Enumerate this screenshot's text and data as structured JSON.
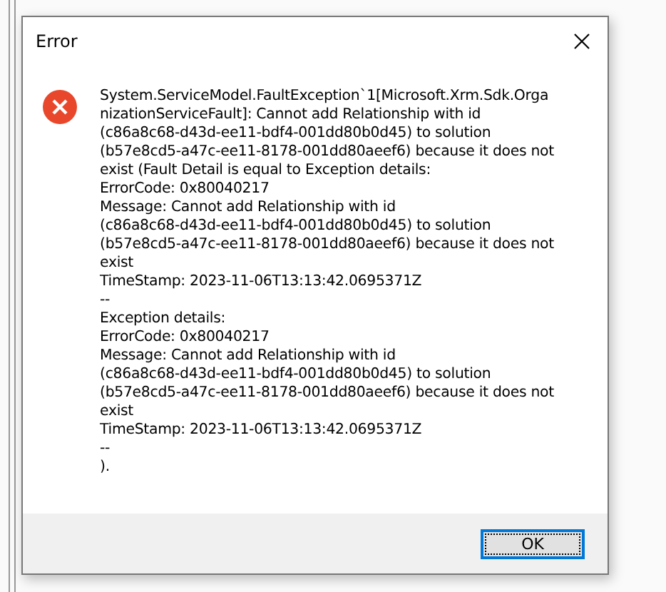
{
  "dialog": {
    "title": "Error",
    "message_lines": [
      "System.ServiceModel.FaultException`1[Microsoft.Xrm.Sdk.Orga",
      "nizationServiceFault]: Cannot add Relationship with id",
      "(c86a8c68-d43d-ee11-bdf4-001dd80b0d45) to solution",
      "(b57e8cd5-a47c-ee11-8178-001dd80aeef6) because it does not",
      "exist (Fault Detail is equal to Exception details:",
      "ErrorCode: 0x80040217",
      "Message: Cannot add Relationship with id",
      "(c86a8c68-d43d-ee11-bdf4-001dd80b0d45) to solution",
      "(b57e8cd5-a47c-ee11-8178-001dd80aeef6) because it does not",
      "exist",
      "TimeStamp: 2023-11-06T13:13:42.0695371Z",
      "--",
      "Exception details:",
      "ErrorCode: 0x80040217",
      "Message: Cannot add Relationship with id",
      "(c86a8c68-d43d-ee11-bdf4-001dd80b0d45) to solution",
      "(b57e8cd5-a47c-ee11-8178-001dd80aeef6) because it does not",
      "exist",
      "TimeStamp: 2023-11-06T13:13:42.0695371Z",
      "--",
      ")."
    ],
    "buttons": [
      {
        "label": "OK",
        "focused": true
      }
    ]
  }
}
